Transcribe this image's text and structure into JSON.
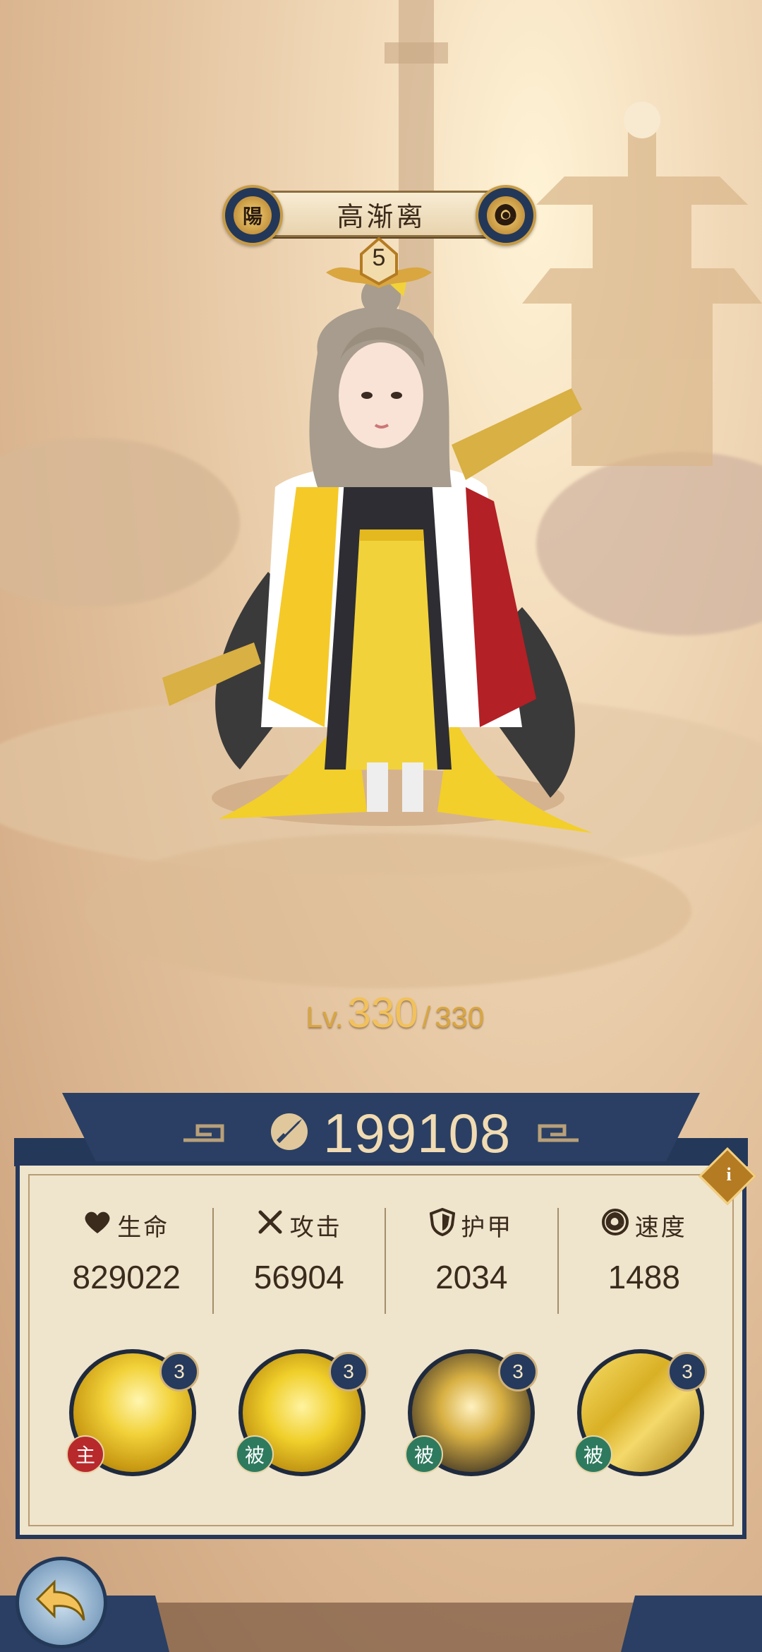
{
  "hero": {
    "name": "高渐离",
    "faction_badge": "陽",
    "element_icon": "triskelion-icon",
    "stars": "5"
  },
  "level": {
    "prefix": "Lv.",
    "current": "330",
    "separator": "/",
    "max": "330"
  },
  "power": {
    "icon": "sword-power-icon",
    "value": "199108"
  },
  "stats": [
    {
      "icon": "heart-icon",
      "label": "生命",
      "value": "829022"
    },
    {
      "icon": "crossed-swords-icon",
      "label": "攻击",
      "value": "56904"
    },
    {
      "icon": "shield-icon",
      "label": "护甲",
      "value": "2034"
    },
    {
      "icon": "swirl-icon",
      "label": "速度",
      "value": "1488"
    }
  ],
  "skills": [
    {
      "level": "3",
      "tag": "主",
      "tag_color": "#b8292c"
    },
    {
      "level": "3",
      "tag": "被",
      "tag_color": "#2e7a5e"
    },
    {
      "level": "3",
      "tag": "被",
      "tag_color": "#2e7a5e"
    },
    {
      "level": "3",
      "tag": "被",
      "tag_color": "#2e7a5e"
    }
  ],
  "info_button": {
    "label": "i"
  },
  "colors": {
    "navy": "#25375a",
    "gold": "#d9a640",
    "panel": "#efe4cc"
  }
}
